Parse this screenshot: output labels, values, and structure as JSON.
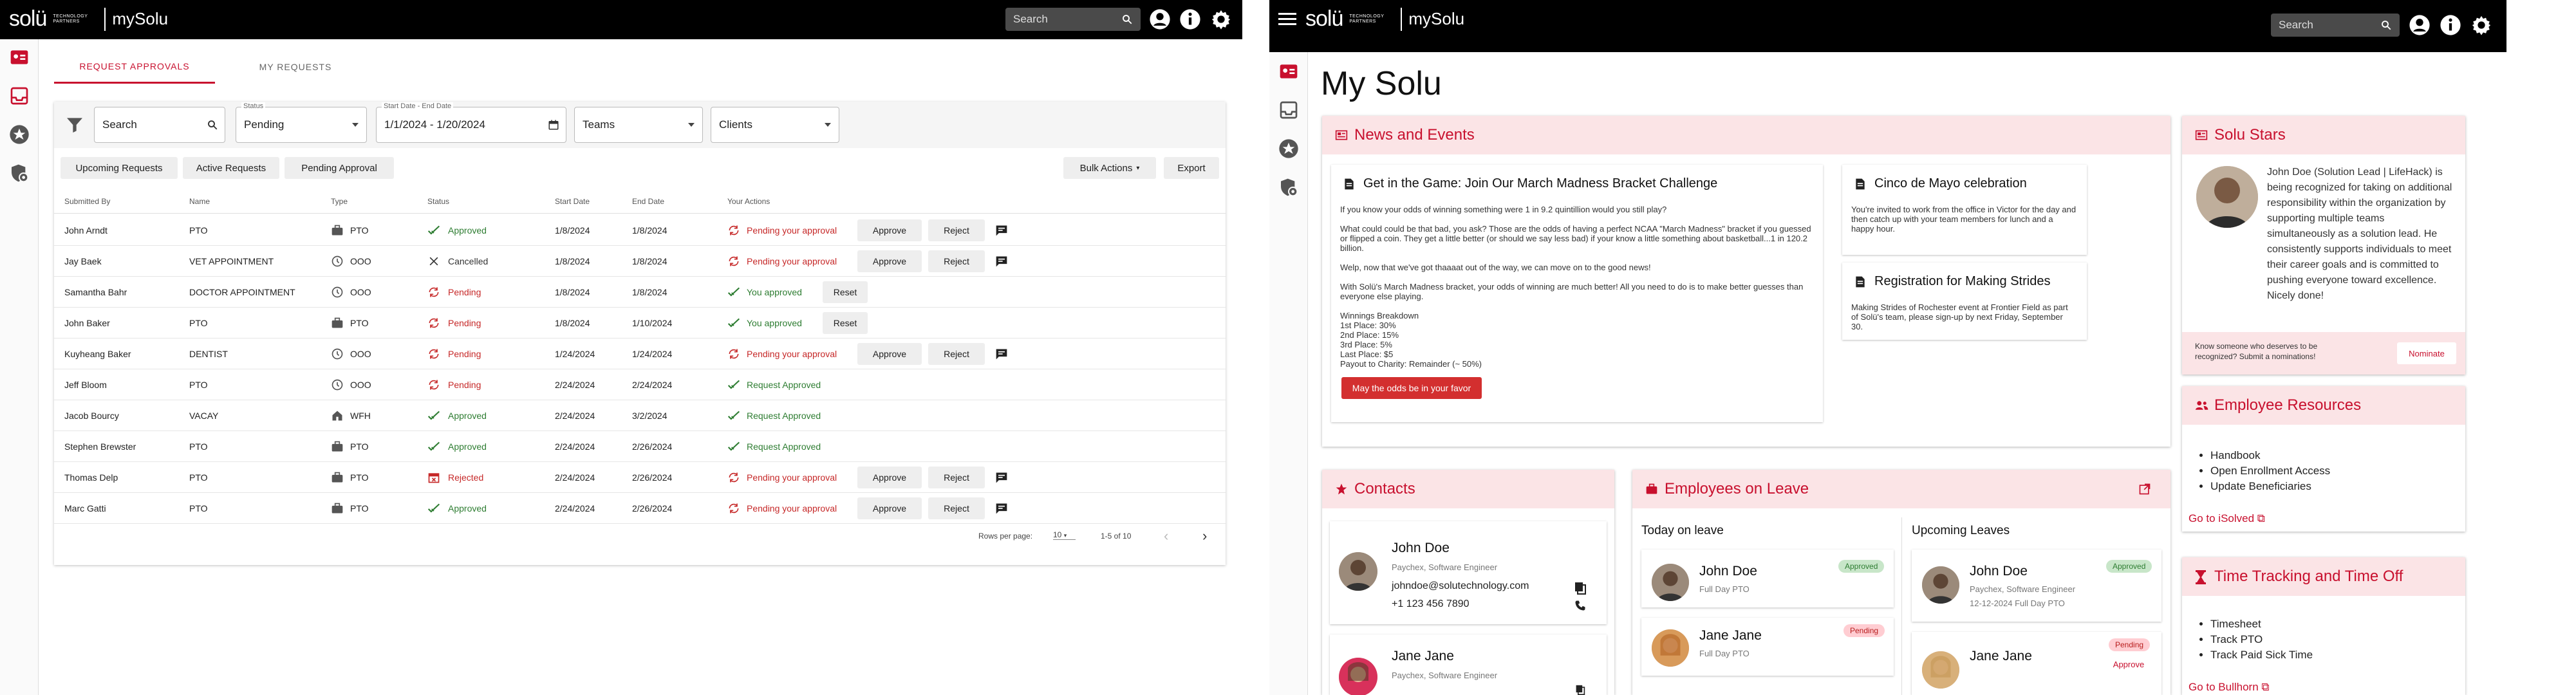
{
  "header": {
    "logo": "solü",
    "logo_sub": "TECHNOLOGY PARTNERS",
    "app": "mySolu",
    "search_placeholder": "Search"
  },
  "screen1": {
    "tabs": [
      "REQUEST APPROVALS",
      "MY REQUESTS"
    ],
    "filters": {
      "search_placeholder": "Search",
      "status_label": "Status",
      "status_value": "Pending",
      "date_label": "Start Date - End Date",
      "date_value": "1/1/2024 - 1/20/2024",
      "teams_value": "Teams",
      "clients_value": "Clients"
    },
    "subtabs": [
      "Upcoming Requests",
      "Active Requests",
      "Pending Approval"
    ],
    "bulk_actions": "Bulk Actions",
    "export": "Export",
    "columns": [
      "Submitted By",
      "Name",
      "Type",
      "Status",
      "Start Date",
      "End Date",
      "Your Actions"
    ],
    "rows": [
      {
        "by": "John Arndt",
        "name": "PTO",
        "type": "PTO",
        "status": "Approved",
        "start": "1/8/2024",
        "end": "1/8/2024",
        "action": "Pending your approval",
        "buttons": [
          "Approve",
          "Reject"
        ],
        "comment": true
      },
      {
        "by": "Jay Baek",
        "name": "VET APPOINTMENT",
        "type": "OOO",
        "status": "Cancelled",
        "start": "1/8/2024",
        "end": "1/8/2024",
        "action": "Pending your approval",
        "buttons": [
          "Approve",
          "Reject"
        ],
        "comment": true
      },
      {
        "by": "Samantha Bahr",
        "name": "DOCTOR APPOINTMENT",
        "type": "OOO",
        "status": "Pending",
        "start": "1/8/2024",
        "end": "1/8/2024",
        "action": "You approved",
        "buttons": [
          "Reset"
        ],
        "comment": false
      },
      {
        "by": "John Baker",
        "name": "PTO",
        "type": "PTO",
        "status": "Pending",
        "start": "1/8/2024",
        "end": "1/10/2024",
        "action": "You approved",
        "buttons": [
          "Reset"
        ],
        "comment": false
      },
      {
        "by": "Kuyheang Baker",
        "name": "DENTIST",
        "type": "OOO",
        "status": "Pending",
        "start": "1/24/2024",
        "end": "1/24/2024",
        "action": "Pending your approval",
        "buttons": [
          "Approve",
          "Reject"
        ],
        "comment": true
      },
      {
        "by": "Jeff Bloom",
        "name": "PTO",
        "type": "OOO",
        "status": "Pending",
        "start": "2/24/2024",
        "end": "2/24/2024",
        "action": "Request Approved",
        "buttons": [],
        "comment": false
      },
      {
        "by": "Jacob Bourcy",
        "name": "VACAY",
        "type": "WFH",
        "status": "Approved",
        "start": "2/24/2024",
        "end": "3/2/2024",
        "action": "Request Approved",
        "buttons": [],
        "comment": false
      },
      {
        "by": "Stephen Brewster",
        "name": "PTO",
        "type": "PTO",
        "status": "Approved",
        "start": "2/24/2024",
        "end": "2/26/2024",
        "action": "Request Approved",
        "buttons": [],
        "comment": false
      },
      {
        "by": "Thomas Delp",
        "name": "PTO",
        "type": "PTO",
        "status": "Rejected",
        "start": "2/24/2024",
        "end": "2/26/2024",
        "action": "Pending your approval",
        "buttons": [
          "Approve",
          "Reject"
        ],
        "comment": true
      },
      {
        "by": "Marc Gatti",
        "name": "PTO",
        "type": "PTO",
        "status": "Approved",
        "start": "2/24/2024",
        "end": "2/26/2024",
        "action": "Pending your approval",
        "buttons": [
          "Approve",
          "Reject"
        ],
        "comment": true
      }
    ],
    "pagination": {
      "rows_label": "Rows per page:",
      "rows_value": "10",
      "range": "1-5 of 10"
    }
  },
  "screen2": {
    "title": "My Solu",
    "news": {
      "heading": "News and Events",
      "main": {
        "title": "Get in the Game: Join Our March Madness Bracket Challenge",
        "body": "If you know your odds of winning something were 1 in 9.2 quintillion would you still play?\n\nWhat could could be that bad, you ask? Those are the odds of having a perfect NCAA \"March Madness\" bracket if you guessed or flipped a coin. They get a little better (or should we say less bad) if your know a little something about basketball...1 in 120.2 billion.\n\nWelp, now that we've got thaaaat out of the way, we can move on to the good news!\n\nWith Solü's March Madness bracket, your odds of winning are much better! All you need to do is to make better guesses than everyone else playing.\n\nWinnings Breakdown\n1st Place: 30%\n2nd Place: 15%\n3rd Place: 5%\nLast Place: $5\nPayout to Charity: Remainder (~ 50%)",
        "button": "May the odds be in your favor"
      },
      "side1": {
        "title": "Cinco de Mayo celebration",
        "body": "You're invited to work from the office in Victor for the day and then catch up with your team members for lunch and a happy hour."
      },
      "side2": {
        "title": "Registration for Making Strides",
        "body": "Making Strides of Rochester event at Frontier Field as part of Solü's team, please sign-up by next Friday, September 30."
      }
    },
    "stars": {
      "heading": "Solu Stars",
      "text": "John Doe (Solution Lead | LifeHack) is being recognized for taking on additional responsibility within the organization by supporting multiple teams simultaneously as a solution lead. He consistently supports individuals to meet their career goals and is committed to pushing everyone toward excellence. Nicely done!",
      "prompt": "Know someone who deserves to be recognized? Submit a nominations!",
      "button": "Nominate"
    },
    "resources": {
      "heading": "Employee Resources",
      "items": [
        "Handbook",
        "Open Enrollment Access",
        "Update Beneficiaries"
      ],
      "link": "Go to iSolved"
    },
    "time": {
      "heading": "Time Tracking and Time Off",
      "items": [
        "Timesheet",
        "Track PTO",
        "Track Paid Sick Time"
      ],
      "link": "Go to Bullhorn"
    },
    "contacts": {
      "heading": "Contacts",
      "people": [
        {
          "name": "John Doe",
          "role": "Paychex, Software Engineer",
          "email": "johndoe@solutechnology.com",
          "phone": "+1 123 456 7890"
        },
        {
          "name": "Jane Jane",
          "role": "Paychex, Software Engineer"
        }
      ]
    },
    "leave": {
      "heading": "Employees on Leave",
      "today_label": "Today on leave",
      "upcoming_label": "Upcoming Leaves",
      "today": [
        {
          "name": "John Doe",
          "detail": "Full Day PTO",
          "status": "Approved"
        },
        {
          "name": "Jane Jane",
          "detail": "Full Day PTO",
          "status": "Pending"
        }
      ],
      "upcoming": [
        {
          "name": "John Doe",
          "role": "Paychex, Software Engineer",
          "date": "12-12-2024 Full Day PTO",
          "status": "Approved"
        },
        {
          "name": "Jane Jane",
          "status": "Pending",
          "button": "Approve"
        }
      ]
    }
  }
}
